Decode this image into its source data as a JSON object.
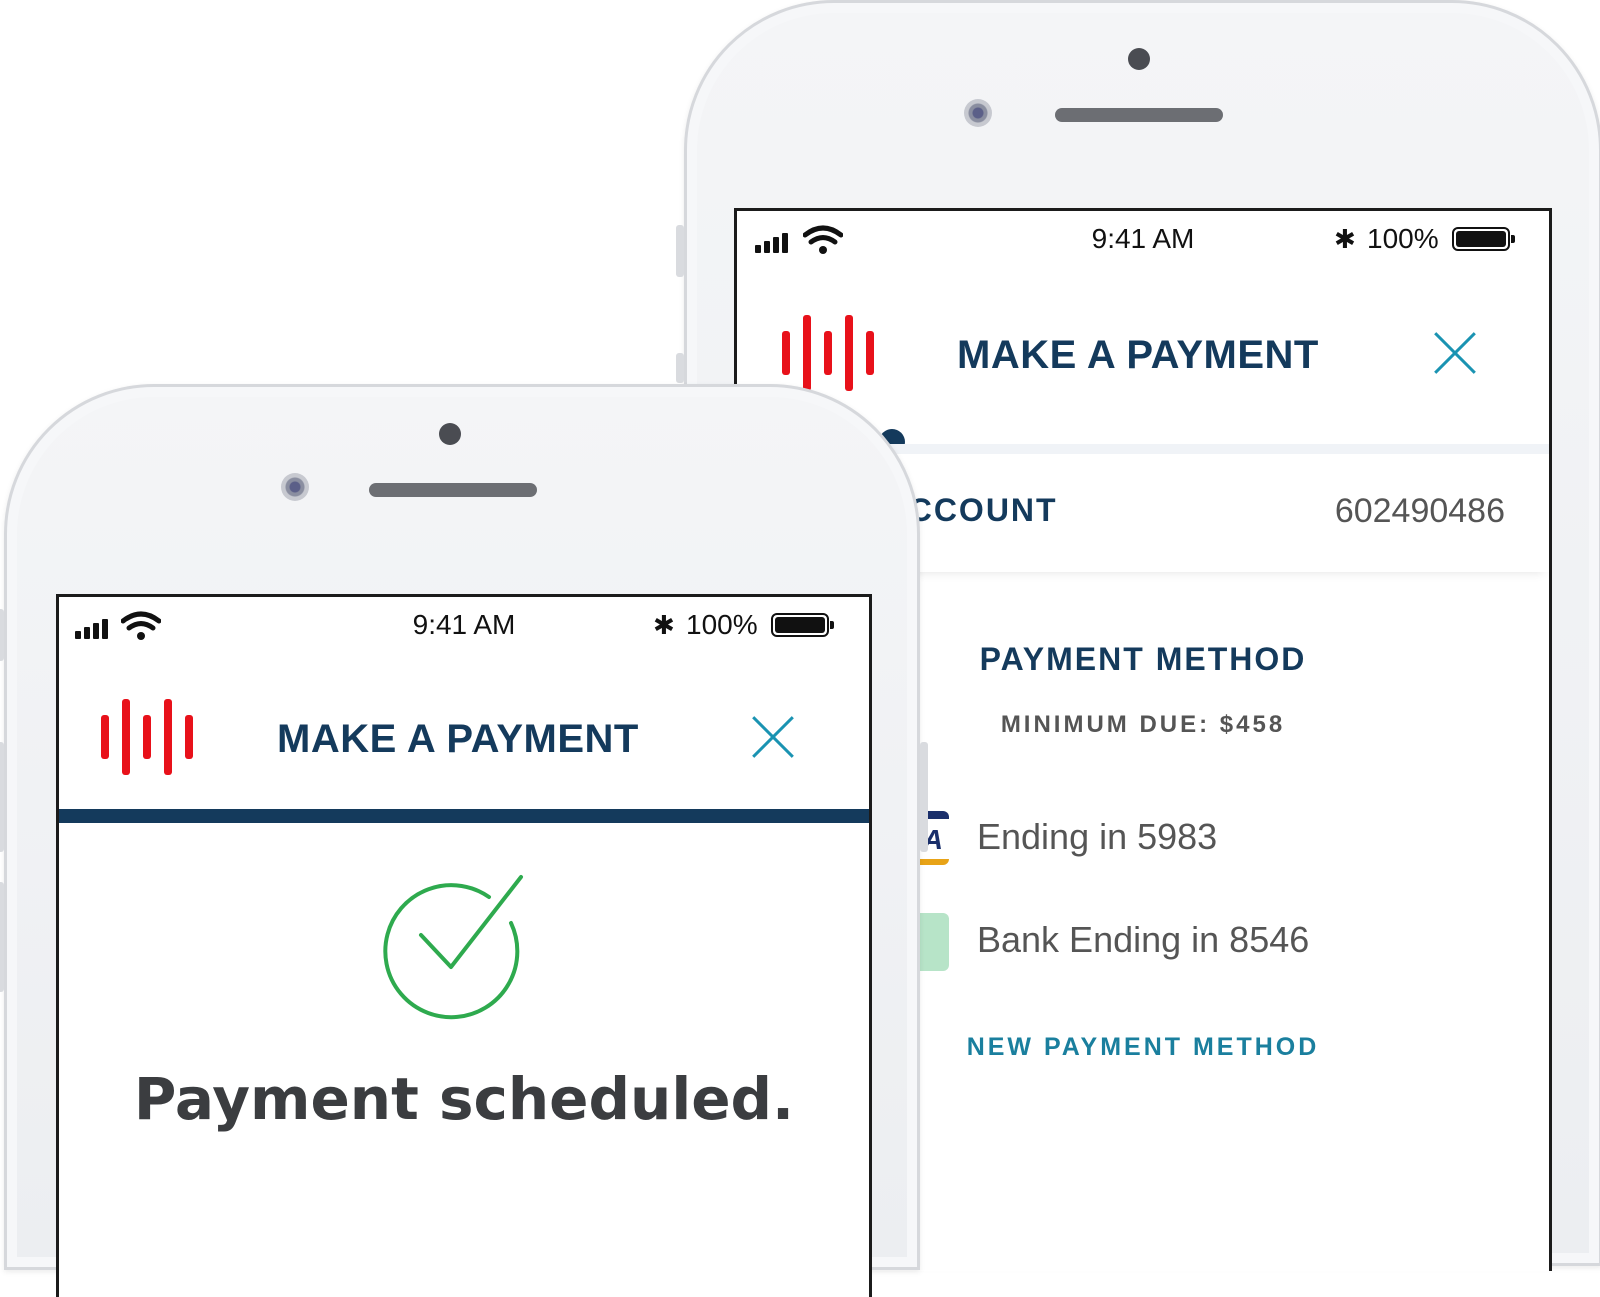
{
  "colors": {
    "brand_red": "#e8111a",
    "navy": "#143a5c",
    "teal": "#1a93b2",
    "success_green": "#2eaa4e"
  },
  "back_phone": {
    "status": {
      "time": "9:41 AM",
      "battery": "100%"
    },
    "header": {
      "title": "MAKE A PAYMENT",
      "close_icon": "close-icon"
    },
    "account": {
      "label": "G ACCOUNT",
      "number": "602490486"
    },
    "payment": {
      "title": "PAYMENT METHOD",
      "minimum_due": "MINIMUM DUE: $458",
      "methods": [
        {
          "label": "Ending in 5983",
          "icon": "visa-card-icon",
          "thumb_text": "A"
        },
        {
          "label": "Bank Ending in 8546",
          "icon": "bank-icon"
        }
      ],
      "new_method": "NEW PAYMENT METHOD"
    }
  },
  "front_phone": {
    "status": {
      "time": "9:41 AM",
      "battery": "100%"
    },
    "header": {
      "title": "MAKE A PAYMENT",
      "close_icon": "close-icon"
    },
    "confirmation": {
      "icon": "check-circle-icon",
      "message": "Payment scheduled."
    }
  }
}
